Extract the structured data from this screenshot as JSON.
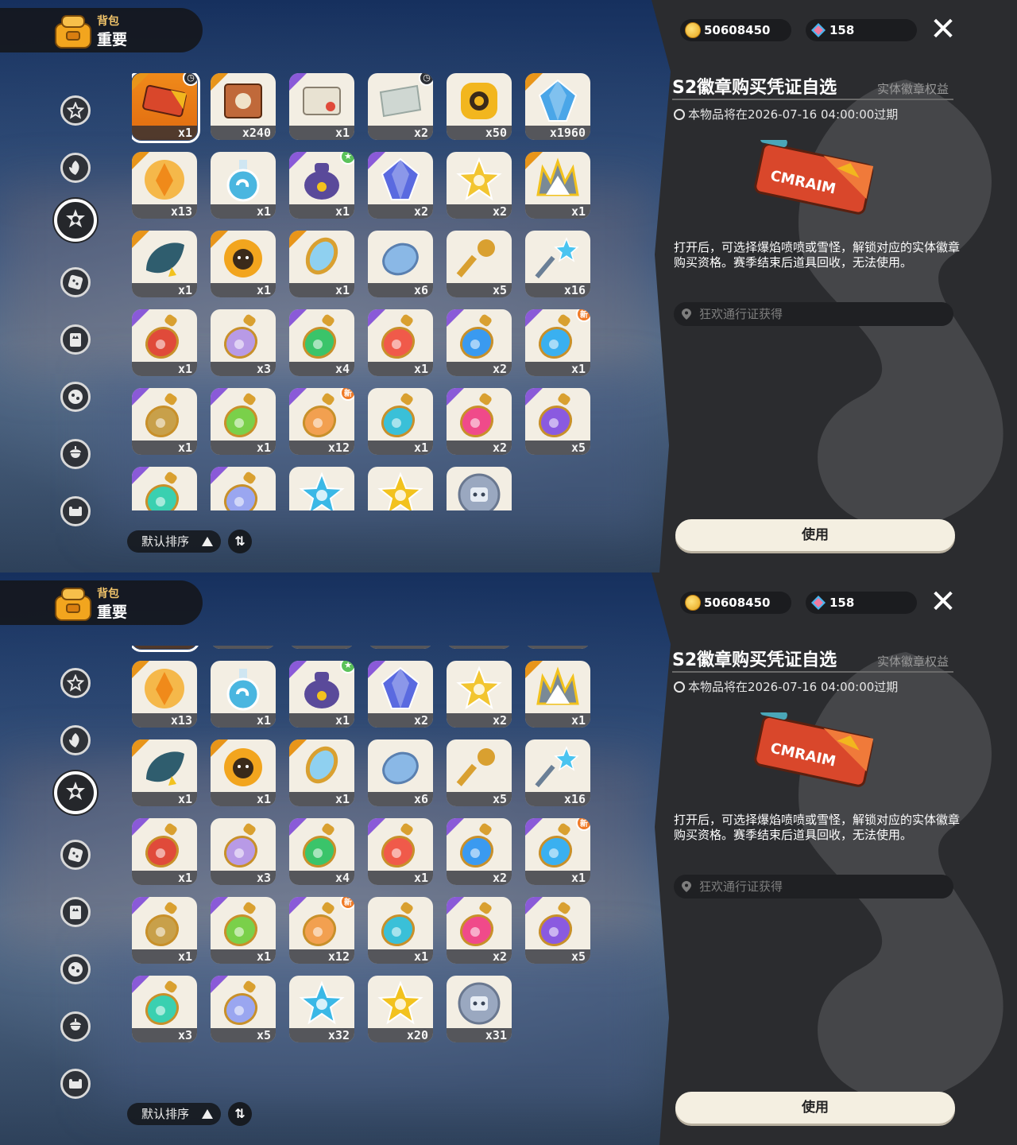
{
  "header": {
    "category": "背包",
    "title": "重要"
  },
  "currency": {
    "gold": "50608450",
    "gems": "158"
  },
  "detail": {
    "name": "S2徽章购买凭证自选",
    "tag": "实体徽章权益",
    "expire": "本物品将在2026-07-16 04:00:00过期",
    "description": "打开后，可选择爆焰喷喷或雪怪，解锁对应的实体徽章购买资格。赛季结束后道具回收，无法使用。",
    "source": "狂欢通行证获得",
    "use_label": "使用"
  },
  "sort": {
    "label": "默认排序",
    "toggle_icon": "⇅"
  },
  "nav_icons": [
    "star-badge-icon",
    "leaf-icon",
    "emblem-icon",
    "dice-icon",
    "crown-card-icon",
    "ball-icon",
    "acorn-icon",
    "chair-icon"
  ],
  "items": [
    {
      "count": "x1",
      "rarity": "orange",
      "art": "ticket",
      "color": "#d9472b",
      "badge": "clock",
      "selected": true
    },
    {
      "count": "x240",
      "rarity": "orange",
      "art": "card",
      "color": "#c0693a",
      "badge": ""
    },
    {
      "count": "x1",
      "rarity": "purple",
      "art": "letter",
      "color": "#e8e2d2",
      "badge": ""
    },
    {
      "count": "x2",
      "rarity": "none",
      "art": "paper",
      "color": "#cfd7d2",
      "badge": "clock"
    },
    {
      "count": "x50",
      "rarity": "none",
      "art": "gear",
      "color": "#f2b61e",
      "badge": ""
    },
    {
      "count": "x1960",
      "rarity": "orange",
      "art": "crystal",
      "color": "#4aa6e8",
      "badge": ""
    },
    {
      "count": "x13",
      "rarity": "orange",
      "art": "shard",
      "color": "#f08a1a",
      "badge": ""
    },
    {
      "count": "x1",
      "rarity": "none",
      "art": "flask",
      "color": "#4ab6e0",
      "badge": ""
    },
    {
      "count": "x1",
      "rarity": "purple",
      "art": "bag",
      "color": "#5a4a9a",
      "badge": "star"
    },
    {
      "count": "x2",
      "rarity": "purple",
      "art": "gem",
      "color": "#5a6ae0",
      "badge": ""
    },
    {
      "count": "x2",
      "rarity": "none",
      "art": "star",
      "color": "#f2c530",
      "badge": ""
    },
    {
      "count": "x1",
      "rarity": "orange",
      "art": "crown",
      "color": "#7a8a96",
      "badge": ""
    },
    {
      "count": "x1",
      "rarity": "orange",
      "art": "leaf",
      "color": "#2f5d6e",
      "badge": ""
    },
    {
      "count": "x1",
      "rarity": "orange",
      "art": "flower",
      "color": "#f2a51e",
      "badge": ""
    },
    {
      "count": "x1",
      "rarity": "orange",
      "art": "mirror",
      "color": "#8fd0f0",
      "badge": ""
    },
    {
      "count": "x6",
      "rarity": "none",
      "art": "disc",
      "color": "#8ab8e6",
      "badge": ""
    },
    {
      "count": "x5",
      "rarity": "none",
      "art": "key",
      "color": "#d9a030",
      "badge": ""
    },
    {
      "count": "x16",
      "rarity": "none",
      "art": "wand",
      "color": "#6a7f96",
      "badge": ""
    },
    {
      "count": "x1",
      "rarity": "purple",
      "art": "potion",
      "color": "#e04a3a",
      "badge": ""
    },
    {
      "count": "x3",
      "rarity": "none",
      "art": "potion",
      "color": "#b89ae6",
      "badge": ""
    },
    {
      "count": "x4",
      "rarity": "purple",
      "art": "potion",
      "color": "#3ac46a",
      "badge": ""
    },
    {
      "count": "x1",
      "rarity": "purple",
      "art": "potion",
      "color": "#f05a4a",
      "badge": ""
    },
    {
      "count": "x2",
      "rarity": "purple",
      "art": "potion",
      "color": "#3a9af0",
      "badge": ""
    },
    {
      "count": "x1",
      "rarity": "purple",
      "art": "potion",
      "color": "#3ab0f0",
      "badge": "new"
    },
    {
      "count": "x1",
      "rarity": "purple",
      "art": "potion",
      "color": "#c8a04a",
      "badge": ""
    },
    {
      "count": "x1",
      "rarity": "purple",
      "art": "potion",
      "color": "#7ad04a",
      "badge": ""
    },
    {
      "count": "x12",
      "rarity": "purple",
      "art": "potion",
      "color": "#f2a050",
      "badge": "new"
    },
    {
      "count": "x1",
      "rarity": "none",
      "art": "potion",
      "color": "#3ac0d8",
      "badge": ""
    },
    {
      "count": "x2",
      "rarity": "purple",
      "art": "potion",
      "color": "#f04a8a",
      "badge": ""
    },
    {
      "count": "x5",
      "rarity": "purple",
      "art": "potion",
      "color": "#8a5ae0",
      "badge": ""
    },
    {
      "count": "x3",
      "rarity": "purple",
      "art": "potion",
      "color": "#3ad0b0",
      "badge": ""
    },
    {
      "count": "x5",
      "rarity": "purple",
      "art": "potion",
      "color": "#9aa6f0",
      "badge": ""
    },
    {
      "count": "x32",
      "rarity": "none",
      "art": "star",
      "color": "#3ab8e6",
      "badge": ""
    },
    {
      "count": "x20",
      "rarity": "none",
      "art": "star",
      "color": "#f2c21e",
      "badge": ""
    },
    {
      "count": "x31",
      "rarity": "none",
      "art": "coin",
      "color": "#9aa8c0",
      "badge": ""
    }
  ],
  "badge_text": {
    "new": "新",
    "star": "★",
    "clock": "◷"
  }
}
